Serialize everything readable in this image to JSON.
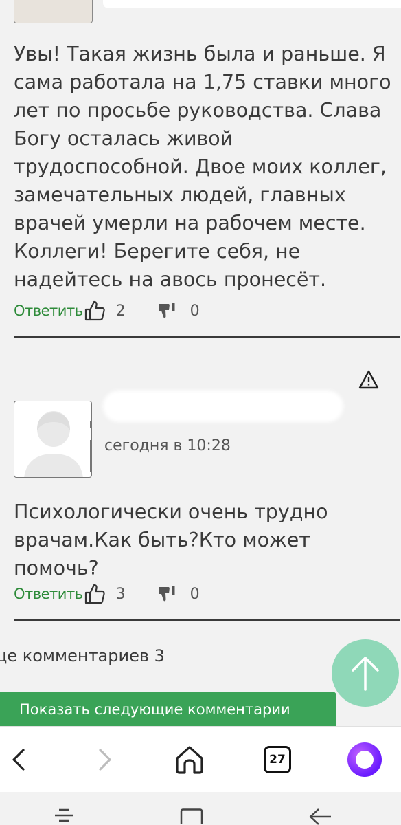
{
  "comments": [
    {
      "text": "Увы! Такая жизнь была и раньше. Я сама работала на 1,75 ставки много лет по просьбе руководства. Слава Богу осталась живой трудоспособной. Двое моих коллег, замечательных людей, главных врачей умерли на рабочем месте. Коллеги! Берегите себя, не надейтесь на авось пронесёт.",
      "reply_label": "Ответить",
      "likes": "2",
      "dislikes": "0"
    },
    {
      "timestamp": "сегодня в 10:28",
      "text": "Психологически очень трудно врачам.Как быть?Кто может помочь?",
      "reply_label": "Ответить",
      "likes": "3",
      "dislikes": "0"
    }
  ],
  "more_comments_label": "це комментариев 3",
  "show_next_button": "Показать следующие комментарии",
  "browser": {
    "tabs_count": "27",
    "icons": [
      "back-icon",
      "forward-icon",
      "home-icon",
      "tabs-icon",
      "alice-assistant-icon"
    ]
  },
  "system_nav": {
    "icons": [
      "recents-icon",
      "home-square-icon",
      "back-nav-icon"
    ]
  },
  "colors": {
    "accent_green": "#3aa357",
    "link_green": "#2e8b3a",
    "scroll_button": "#8fd8b8"
  }
}
